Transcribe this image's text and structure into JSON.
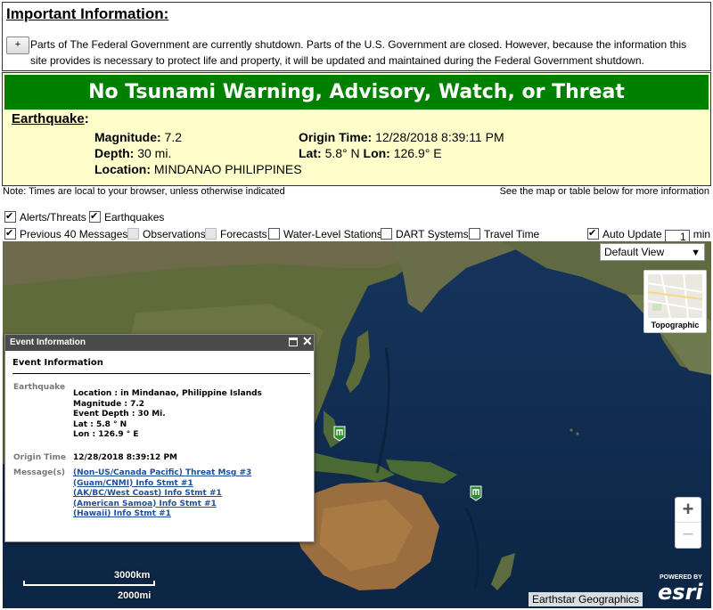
{
  "notice": {
    "title": "Important Information:",
    "toggle": "+",
    "text": "Parts of The Federal Government are currently shutdown. Parts of the U.S. Government are closed. However, because the information this site provides is necessary to protect life and property, it will be updated and maintained during the Federal Government shutdown."
  },
  "status": {
    "banner": "No Tsunami Warning, Advisory, Watch, or Threat",
    "banner_color": "#008000",
    "panel_color": "#ffffcc",
    "event_label": "Earthquake",
    "magnitude_label": "Magnitude:",
    "magnitude_value": "7.2",
    "depth_label": "Depth:",
    "depth_value": "30 mi.",
    "location_label": "Location:",
    "location_value": "MINDANAO PHILIPPINES",
    "origin_label": "Origin Time:",
    "origin_value": "12/28/2018 8:39:11 PM",
    "lat_label": "Lat:",
    "lat_value": "5.8° N",
    "lon_label": "Lon:",
    "lon_value": "126.9° E"
  },
  "notes": {
    "left": "Note: Times are local to your browser, unless otherwise indicated",
    "right": "See the map or table below for more information"
  },
  "layers": {
    "alerts": "Alerts/Threats",
    "earthquakes": "Earthquakes",
    "previous": "Previous 40 Messages",
    "observations": "Observations",
    "forecasts": "Forecasts",
    "water_level": "Water-Level Stations",
    "dart": "DART Systems",
    "travel_time": "Travel Time",
    "auto_update": "Auto Update",
    "auto_value": "1",
    "auto_unit": "min"
  },
  "map": {
    "view_select": "Default View",
    "basemap_label": "Topographic",
    "zoom_in": "+",
    "zoom_out": "−",
    "scale_km": "3000km",
    "scale_mi": "2000mi",
    "attribution": "Earthstar Geographics",
    "powered": "POWERED BY",
    "esri": "esri"
  },
  "popup": {
    "header": "Event Information",
    "title": "Event Information",
    "eq_label": "Earthquake",
    "location": "Location : in Mindanao, Philippine Islands",
    "magnitude": "Magnitude : 7.2",
    "depth": "Event Depth : 30 Mi.",
    "lat": "Lat : 5.8 ° N",
    "lon": "Lon : 126.9 ° E",
    "origin_label": "Origin Time",
    "origin_value": "12/28/2018 8:39:12 PM",
    "messages_label": "Message(s)",
    "messages": [
      "(Non-US/Canada Pacific) Threat Msg #3",
      "(Guam/CNMI) Info Stmt #1",
      "(AK/BC/West Coast) Info Stmt #1",
      "(American Samoa) Info Stmt #1",
      "(Hawaii) Info Stmt #1"
    ]
  }
}
